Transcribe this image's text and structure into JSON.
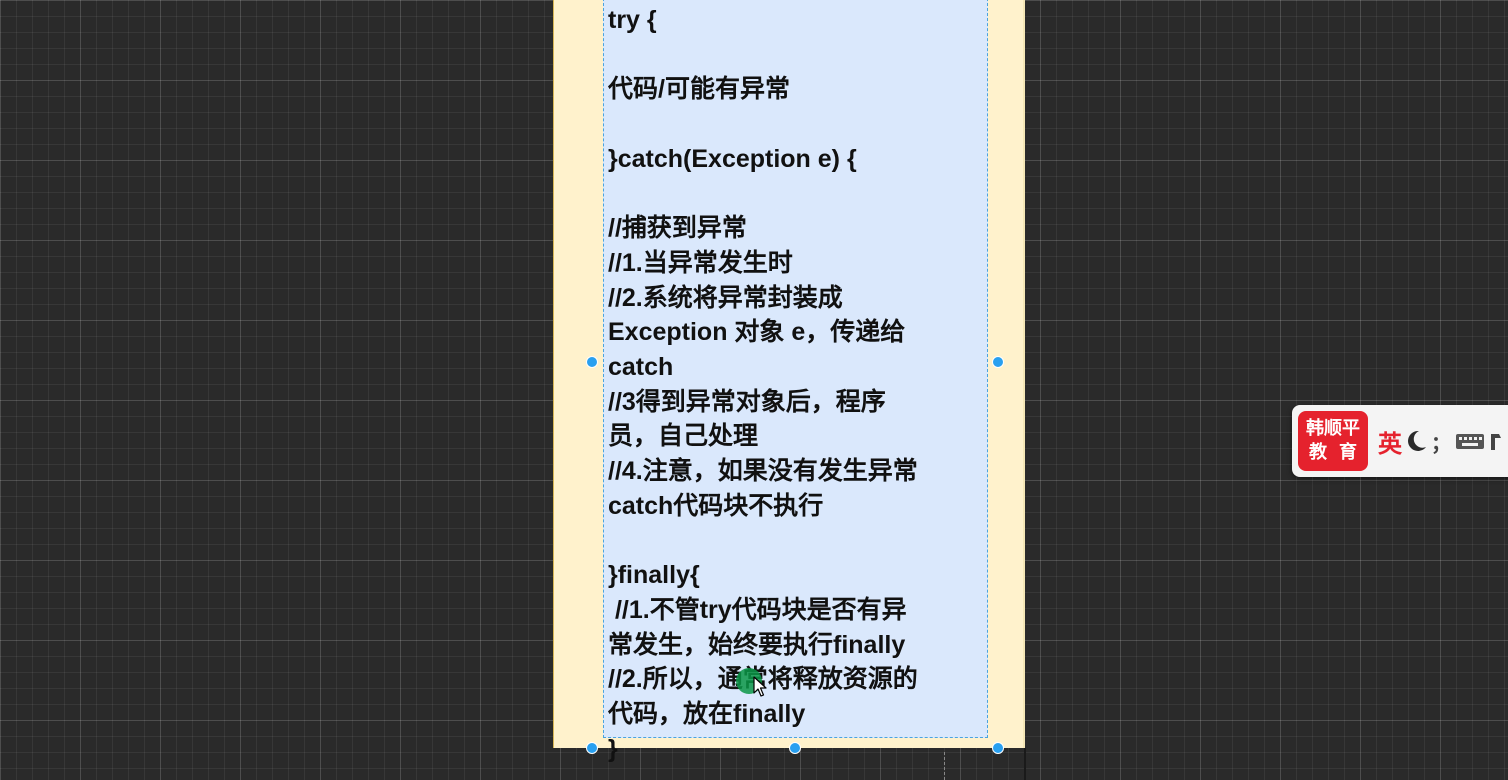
{
  "canvas": {
    "background_color": "#2a2a2a"
  },
  "diagram": {
    "outer_fill": "#fff2cc",
    "text_fill": "#dae8fc",
    "selection_color": "#29a0f0",
    "code_lines": [
      "try {",
      "",
      "代码/可能有异常",
      "",
      "}catch(Exception e) {",
      "",
      "//捕获到异常",
      "//1.当异常发生时",
      "//2.系统将异常封装成",
      "Exception 对象 e，传递给",
      "catch",
      "//3得到异常对象后，程序",
      "员，自己处理",
      "//4.注意，如果没有发生异常",
      "catch代码块不执行",
      "",
      "}finally{",
      " //1.不管try代码块是否有异",
      "常发生，始终要执行finally",
      "//2.所以，通常将释放资源的",
      "代码，放在finally",
      "}"
    ]
  },
  "ime_toolbar": {
    "logo_line1": "韩顺平",
    "logo_line2": "教育",
    "logo_color": "#e5222d",
    "language": "英",
    "mode_icon": "moon-icon",
    "punctuation": "；",
    "keyboard_icon": "keyboard-icon"
  }
}
